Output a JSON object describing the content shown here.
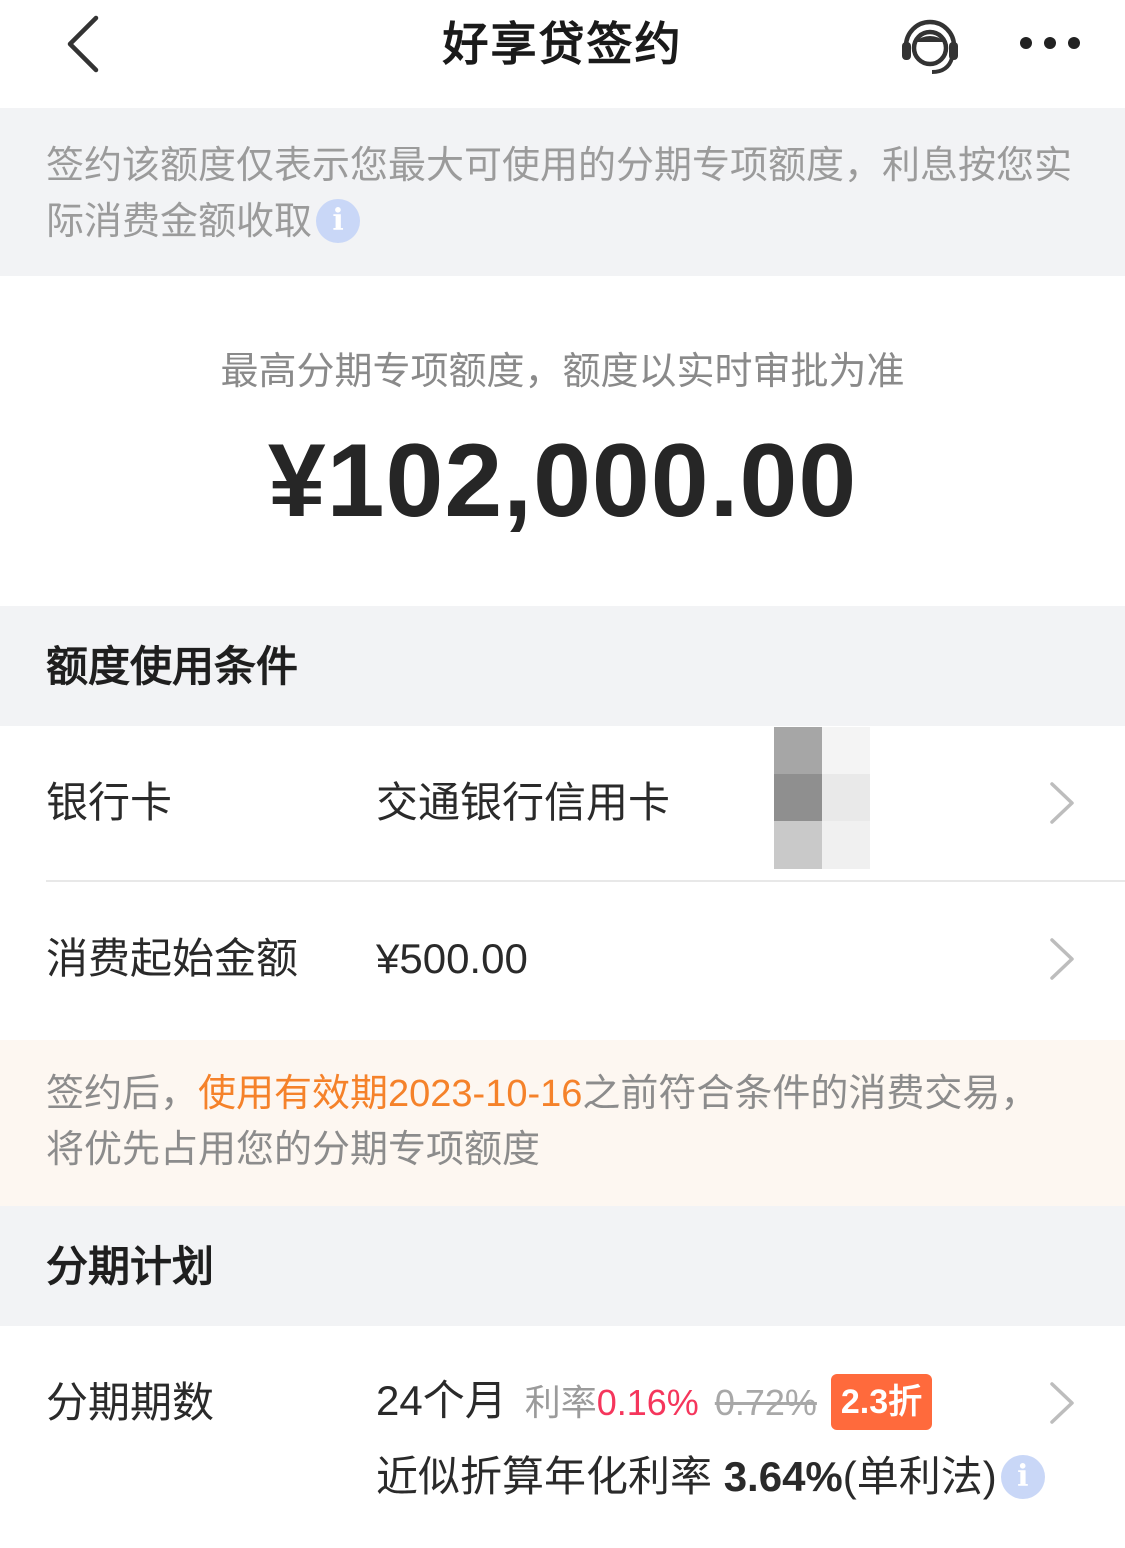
{
  "nav": {
    "title": "好享贷签约",
    "back_icon": "chevron-left-icon",
    "service_icon": "customer-service-icon",
    "more_icon": "more-dots-icon"
  },
  "notice": {
    "text": "签约该额度仅表示您最大可使用的分期专项额度，利息按您实际消费金额收取",
    "info_icon": "info-icon"
  },
  "quota": {
    "caption": "最高分期专项额度，额度以实时审批为准",
    "amount": "¥102,000.00"
  },
  "conditions": {
    "header": "额度使用条件",
    "bank_card": {
      "label": "银行卡",
      "value": "交通银行信用卡"
    },
    "min_amount": {
      "label": "消费起始金额",
      "value": "¥500.00"
    }
  },
  "hint": {
    "prefix": "签约后，",
    "highlight": "使用有效期2023-10-16",
    "suffix": "之前符合条件的消费交易，将优先占用您的分期专项额度"
  },
  "plan": {
    "header": "分期计划",
    "term_label": "分期期数",
    "term_value": "24个月",
    "rate_label": "利率",
    "rate_new": "0.16%",
    "rate_old": "0.72%",
    "discount": "2.3折",
    "apr_label": "近似折算年化利率",
    "apr_value": "3.64%",
    "apr_method": "(单利法)"
  },
  "colors": {
    "accent_orange": "#f5822a",
    "rate_red": "#f5365c",
    "discount_bg": "#ff6a3c",
    "info_blue": "#c9d7f7"
  }
}
